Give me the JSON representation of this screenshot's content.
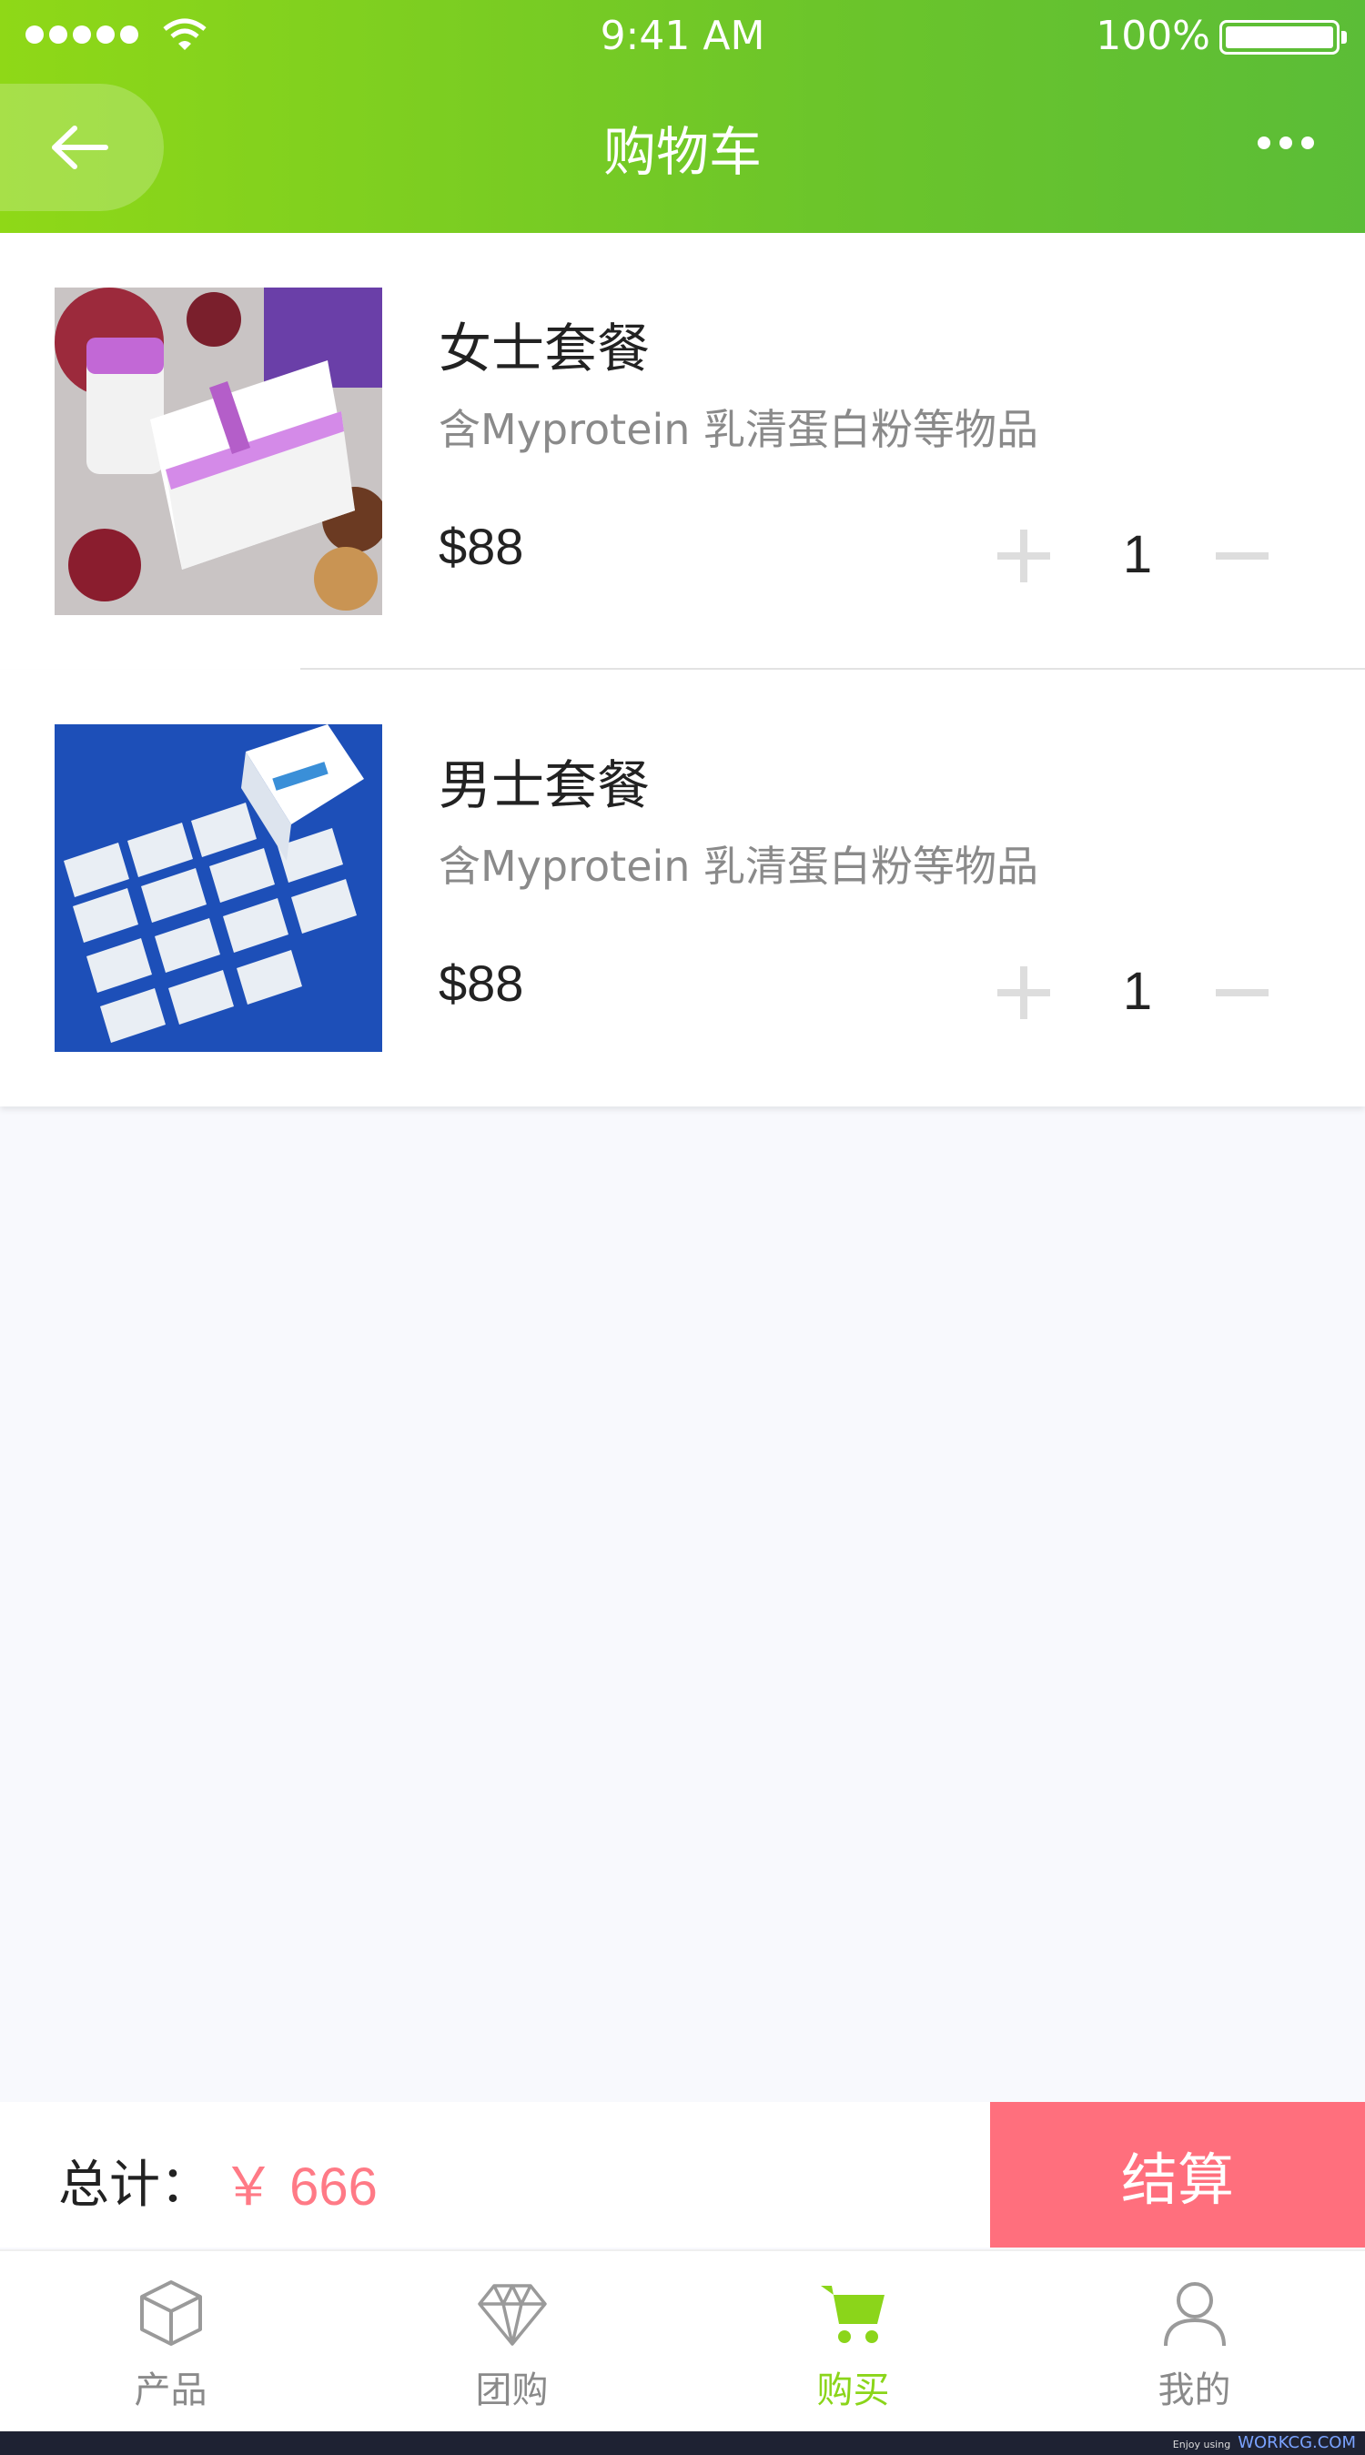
{
  "status": {
    "time": "9:41 AM",
    "battery": "100%"
  },
  "header": {
    "title": "购物车"
  },
  "items": [
    {
      "name": "女士套餐",
      "desc": "含Myprotein 乳清蛋白粉等物品",
      "price": "$88",
      "qty": "1"
    },
    {
      "name": "男士套餐",
      "desc": "含Myprotein 乳清蛋白粉等物品",
      "price": "$88",
      "qty": "1"
    }
  ],
  "checkout": {
    "total_label": "总计：",
    "total_amount": "￥ 666",
    "button": "结算"
  },
  "tabs": [
    {
      "label": "产品",
      "icon": "box-icon"
    },
    {
      "label": "团购",
      "icon": "diamond-icon"
    },
    {
      "label": "购买",
      "icon": "cart-icon"
    },
    {
      "label": "我的",
      "icon": "user-icon"
    }
  ],
  "active_tab": "购买",
  "colors": {
    "header_green": "#7fcf22",
    "accent_green": "#8bd51a",
    "checkout_pink": "#ff6f7d",
    "price_pink": "#ff7a86"
  },
  "footer": {
    "enjoy": "Enjoy using",
    "site": "WORKCG.COM"
  }
}
